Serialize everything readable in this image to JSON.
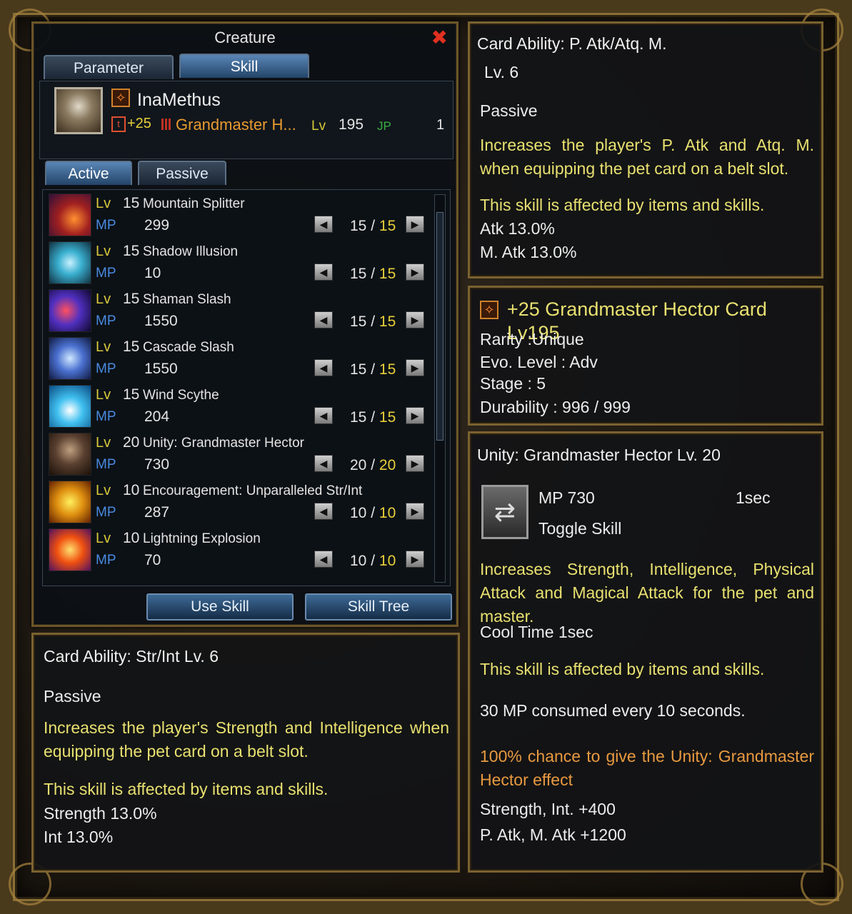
{
  "creature": {
    "title": "Creature",
    "tabs": [
      "Parameter",
      "Skill"
    ],
    "name": "InaMethus",
    "enhance": "+25",
    "card_name": "Grandmaster H...",
    "lv_label": "Lv",
    "lv_value": "195",
    "jp_label": "JP",
    "jp_value": "1",
    "subtabs": [
      "Active",
      "Passive"
    ],
    "skills": [
      {
        "lv": "15",
        "name": "Mountain Splitter",
        "mp": "299",
        "cur": "15",
        "max": "15"
      },
      {
        "lv": "15",
        "name": "Shadow Illusion",
        "mp": "10",
        "cur": "15",
        "max": "15"
      },
      {
        "lv": "15",
        "name": "Shaman Slash",
        "mp": "1550",
        "cur": "15",
        "max": "15"
      },
      {
        "lv": "15",
        "name": "Cascade Slash",
        "mp": "1550",
        "cur": "15",
        "max": "15"
      },
      {
        "lv": "15",
        "name": "Wind Scythe",
        "mp": "204",
        "cur": "15",
        "max": "15"
      },
      {
        "lv": "20",
        "name": "Unity: Grandmaster Hector",
        "mp": "730",
        "cur": "20",
        "max": "20"
      },
      {
        "lv": "10",
        "name": "Encouragement: Unparalleled Str/Int",
        "mp": "287",
        "cur": "10",
        "max": "10"
      },
      {
        "lv": "10",
        "name": "Lightning Explosion",
        "mp": "70",
        "cur": "10",
        "max": "10"
      }
    ],
    "lv_word": "Lv",
    "mp_word": "MP",
    "slash": "/",
    "use_skill": "Use Skill",
    "skill_tree": "Skill Tree"
  },
  "card_str": {
    "title": "Card Ability: Str/Int Lv. 6",
    "type": "Passive",
    "desc": "Increases the player's Strength and Intelligence when equipping the pet card on a belt slot.",
    "affected": "This skill is affected by items and skills.",
    "stat1": "Strength 13.0%",
    "stat2": "Int 13.0%"
  },
  "card_atk": {
    "title1": "Card Ability: P. Atk/Atq. M.",
    "title2": "Lv. 6",
    "type": "Passive",
    "desc": "Increases the player's P. Atk and Atq. M. when equipping the pet card on a belt slot.",
    "affected": "This skill is affected by items and skills.",
    "stat1": "Atk 13.0%",
    "stat2": "M. Atk 13.0%"
  },
  "card_item": {
    "title": "+25 Grandmaster Hector Card  Lv195",
    "rarity": "Rarity :Unique",
    "evo": "Evo. Level : Adv",
    "stage": "Stage : 5",
    "durability": "Durability : 996 / 999"
  },
  "unity": {
    "title": "Unity: Grandmaster Hector Lv. 20",
    "mp": "MP 730",
    "time": "1sec",
    "kind": "Toggle Skill",
    "desc": "Increases Strength, Intelligence, Physical Attack and Magical Attack for the pet and master.",
    "cool": "Cool Time 1sec",
    "affected": "This skill is affected by items and skills.",
    "consume": "30 MP consumed every 10 seconds.",
    "chance": "100% chance to give the Unity: Grandmaster Hector effect",
    "stat1": "Strength, Int. +400",
    "stat2": "P. Atk, M. Atk +1200"
  },
  "colors": {
    "gold_text": "#e8e070",
    "orange_text": "#e89a40",
    "close": "#e03020",
    "mp_blue": "#4a8ae0"
  }
}
